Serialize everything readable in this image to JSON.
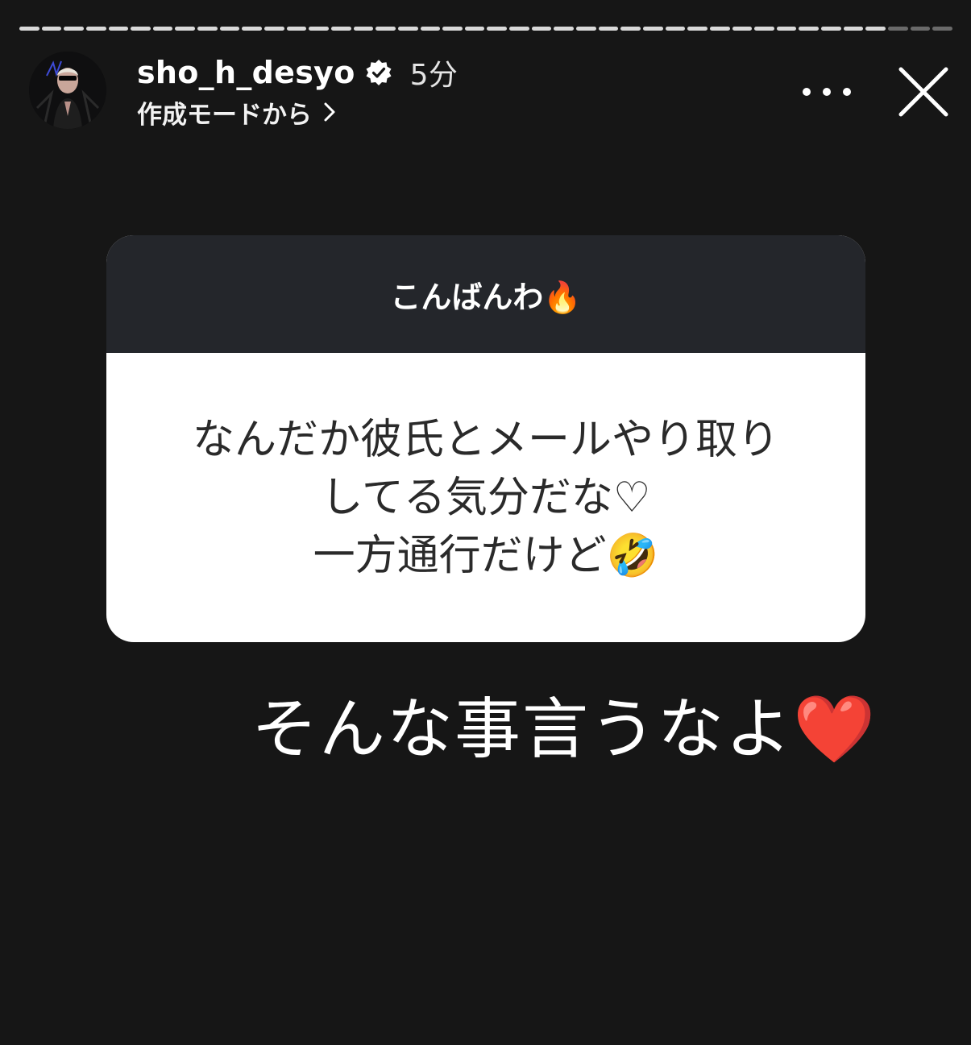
{
  "story": {
    "progress_segments": 42,
    "progress_viewed": 39
  },
  "header": {
    "username": "sho_h_desyo",
    "verified": true,
    "timestamp": "5分",
    "subtitle": "作成モードから",
    "more_icon": "more-horizontal-icon",
    "close_icon": "close-icon"
  },
  "question_card": {
    "prompt": "こんばんわ🔥",
    "response_lines": [
      "なんだか彼氏とメールやり取り",
      "してる気分だな♡",
      "一方通行だけど🤣"
    ]
  },
  "caption": {
    "text": "そんな事言うなよ❤️"
  },
  "colors": {
    "background": "#161616",
    "card_header": "#24262b",
    "card_body": "#ffffff",
    "card_text": "#2a2a2a"
  }
}
